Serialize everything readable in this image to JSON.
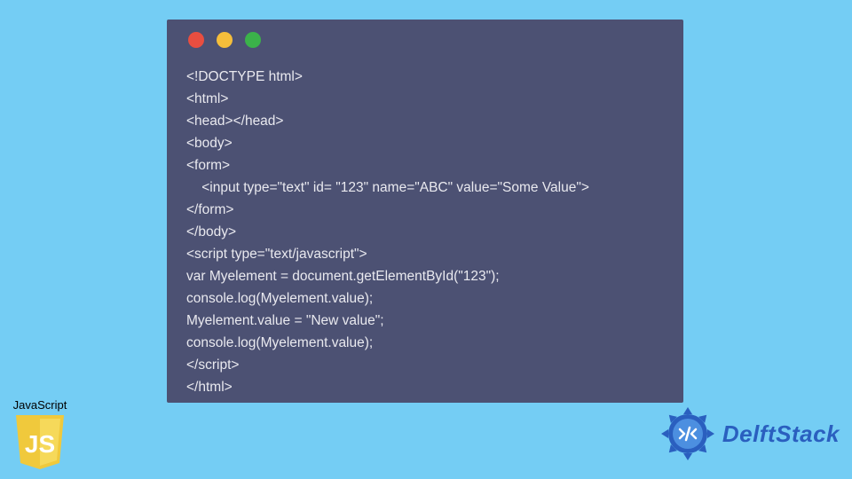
{
  "code_window": {
    "lines": [
      "<!DOCTYPE html>",
      "<html>",
      "<head></head>",
      "<body>",
      "<form>",
      "    <input type=\"text\" id= \"123\" name=\"ABC\" value=\"Some Value\">",
      "</form>",
      "</body>",
      "<script type=\"text/javascript\">",
      "var Myelement = document.getElementById(\"123\");",
      "console.log(Myelement.value);",
      "Myelement.value = \"New value\";",
      "console.log(Myelement.value);",
      "</script>",
      "</html>"
    ]
  },
  "js_badge": {
    "label": "JavaScript",
    "shield_text": "JS"
  },
  "delftstack": {
    "text": "DelftStack"
  }
}
